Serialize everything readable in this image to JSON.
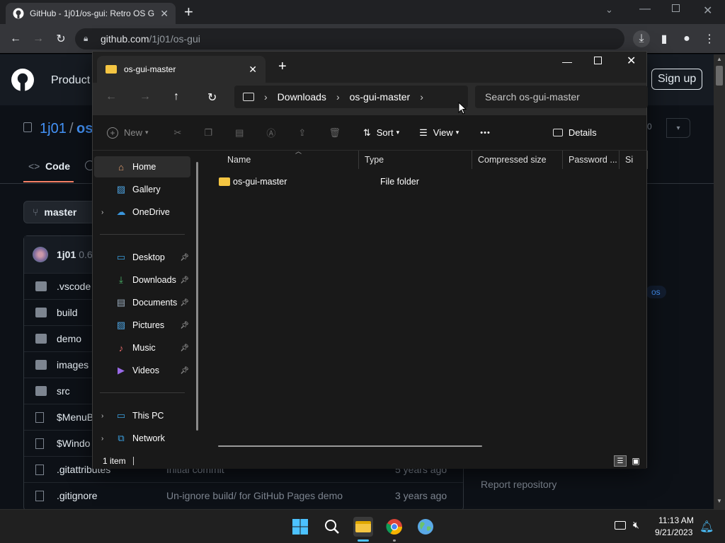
{
  "browser": {
    "tab_title": "GitHub - 1j01/os-gui: Retro OS G",
    "new_tab": "+",
    "url_host": "github.com",
    "url_path": "/1j01/os-gui"
  },
  "github": {
    "product_label": "Product",
    "signup_label": "Sign up",
    "owner": "1j01",
    "slash": "/",
    "repo": "os",
    "code_tab": "Code",
    "branch": "master",
    "commit_author": "1j01",
    "commit_version": "0.6.",
    "sidebar_tag": "os",
    "report_label": "Report repository",
    "count_badge": "0",
    "files": [
      {
        "name": ".vscode",
        "type": "folder",
        "msg": "",
        "age": ""
      },
      {
        "name": "build",
        "type": "folder",
        "msg": "",
        "age": ""
      },
      {
        "name": "demo",
        "type": "folder",
        "msg": "",
        "age": ""
      },
      {
        "name": "images",
        "type": "folder",
        "msg": "",
        "age": ""
      },
      {
        "name": "src",
        "type": "folder",
        "msg": "",
        "age": ""
      },
      {
        "name": "$MenuB",
        "type": "file",
        "msg": "",
        "age": ""
      },
      {
        "name": "$Windo",
        "type": "file",
        "msg": "",
        "age": ""
      },
      {
        "name": ".gitattributes",
        "type": "file",
        "msg": "Initial commit",
        "age": "5 years ago"
      },
      {
        "name": ".gitignore",
        "type": "file",
        "msg": "Un-ignore build/ for GitHub Pages demo",
        "age": "3 years ago"
      }
    ]
  },
  "explorer": {
    "tab_title": "os-gui-master",
    "new_tab": "+",
    "breadcrumb": [
      "Downloads",
      "os-gui-master"
    ],
    "search_placeholder": "Search os-gui-master",
    "commands": {
      "new": "New",
      "sort": "Sort",
      "view": "View",
      "more": "•••",
      "details": "Details"
    },
    "nav": [
      {
        "label": "Home",
        "icon": "home-icon",
        "pinned": false,
        "expand": false,
        "selected": true
      },
      {
        "label": "Gallery",
        "icon": "gallery-icon",
        "pinned": false,
        "expand": false,
        "selected": false
      },
      {
        "label": "OneDrive",
        "icon": "cloud-icon",
        "pinned": false,
        "expand": true,
        "selected": false
      },
      {
        "label": "Desktop",
        "icon": "desktop-icon",
        "pinned": true,
        "expand": false,
        "selected": false
      },
      {
        "label": "Downloads",
        "icon": "download-icon",
        "pinned": true,
        "expand": false,
        "selected": false
      },
      {
        "label": "Documents",
        "icon": "document-icon",
        "pinned": true,
        "expand": false,
        "selected": false
      },
      {
        "label": "Pictures",
        "icon": "pictures-icon",
        "pinned": true,
        "expand": false,
        "selected": false
      },
      {
        "label": "Music",
        "icon": "music-icon",
        "pinned": true,
        "expand": false,
        "selected": false
      },
      {
        "label": "Videos",
        "icon": "videos-icon",
        "pinned": true,
        "expand": false,
        "selected": false
      },
      {
        "label": "This PC",
        "icon": "computer-icon",
        "pinned": false,
        "expand": true,
        "selected": false
      },
      {
        "label": "Network",
        "icon": "network-icon",
        "pinned": false,
        "expand": true,
        "selected": false
      }
    ],
    "columns": [
      "Name",
      "Type",
      "Compressed size",
      "Password ...",
      "Si"
    ],
    "items": [
      {
        "name": "os-gui-master",
        "type": "File folder"
      }
    ],
    "status": "1 item"
  },
  "taskbar": {
    "time": "11:13 AM",
    "date": "9/21/2023"
  },
  "colors": {
    "accent": "#4493f8",
    "folder": "#f4c542",
    "explorer_bg": "#191919"
  }
}
